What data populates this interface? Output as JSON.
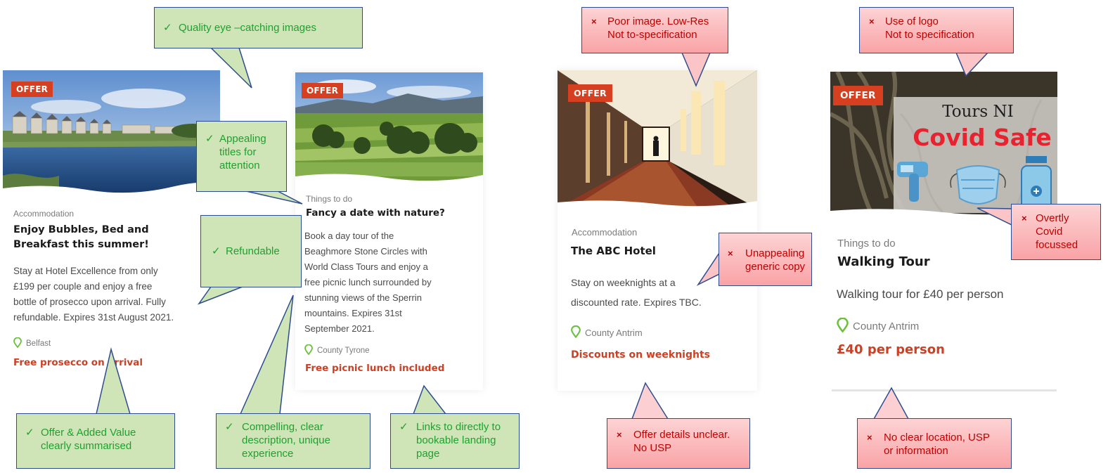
{
  "cards": [
    {
      "offer": "OFFER",
      "category": "Accommodation",
      "title_lines": [
        "Enjoy Bubbles, Bed and",
        "Breakfast this summer!"
      ],
      "desc_lines": [
        "Stay at Hotel Excellence from only",
        "£199 per couple and enjoy a free",
        "bottle of prosecco upon arrival. Fully",
        "refundable. Expires 31st August 2021."
      ],
      "location": "Belfast",
      "usp": "Free prosecco on arrival"
    },
    {
      "offer": "OFFER",
      "category": "Things to do",
      "title_lines": [
        "Fancy a date with nature?"
      ],
      "desc_lines": [
        "Book a day tour of the",
        "Beaghmore Stone Circles with",
        "World Class Tours and enjoy a",
        "free picnic lunch surrounded by",
        "stunning views of the Sperrin",
        "mountains. Expires 31st",
        "September 2021."
      ],
      "location": "County Tyrone",
      "usp": "Free picnic lunch included"
    },
    {
      "offer": "OFFER",
      "category": "Accommodation",
      "title_lines": [
        "The ABC Hotel"
      ],
      "desc_lines": [
        "Stay on weeknights at a",
        "discounted rate. Expires TBC."
      ],
      "location": "County Antrim",
      "usp": "Discounts on weeknights"
    },
    {
      "offer": "OFFER",
      "category": "Things to do",
      "title_lines": [
        "Walking Tour"
      ],
      "desc_lines": [
        "Walking tour for £40 per person"
      ],
      "location": "County Antrim",
      "usp": "£40 per person",
      "image_text": {
        "line1": "Tours NI",
        "line2": "Covid Safe"
      }
    }
  ],
  "callouts": {
    "good": [
      {
        "lines": [
          "Quality eye –catching images"
        ]
      },
      {
        "lines": [
          "Appealing",
          "titles for",
          "attention"
        ]
      },
      {
        "lines": [
          "Refundable"
        ]
      },
      {
        "lines": [
          "Offer & Added Value",
          "clearly summarised"
        ]
      },
      {
        "lines": [
          "Compelling, clear",
          "description, unique",
          "experience"
        ]
      },
      {
        "lines": [
          "Links to directly to",
          "bookable landing",
          "page"
        ]
      }
    ],
    "bad": [
      {
        "lines": [
          "Poor image. Low-Res",
          "Not to-specification"
        ]
      },
      {
        "lines": [
          "Use of logo",
          "Not to specification"
        ]
      },
      {
        "lines": [
          "Unappealing",
          "generic copy"
        ]
      },
      {
        "lines": [
          "Overtly",
          "Covid",
          "focussed"
        ]
      },
      {
        "lines": [
          "Offer details unclear.",
          "No USP"
        ]
      },
      {
        "lines": [
          "No clear location, USP",
          "or information"
        ]
      }
    ],
    "good_mark": "✓",
    "bad_mark": "×"
  },
  "colors": {
    "offer_badge": "#d63f20",
    "usp_text": "#cc4125",
    "good_bg": "#cfe5b8",
    "good_text": "#1ea12e",
    "bad_bg": "#f9a3a6",
    "bad_text": "#c00000",
    "callout_border": "#2e4d8f",
    "pin": "#6abf3b"
  }
}
